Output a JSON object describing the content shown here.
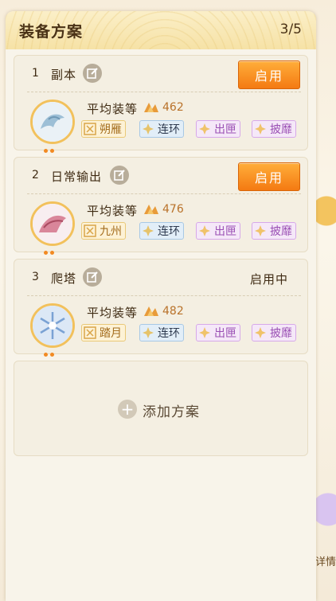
{
  "panel": {
    "title": "装备方案",
    "count": "3/5"
  },
  "plans": [
    {
      "num": "1",
      "name": "副本",
      "button": "启用",
      "avg_label": "平均装等",
      "avg_value": "462",
      "tags": {
        "gold": "朔雁",
        "blue": "连环",
        "purple1": "出匣",
        "purple2": "披靡"
      },
      "avatar": "dragon-avatar"
    },
    {
      "num": "2",
      "name": "日常输出",
      "button": "启用",
      "avg_label": "平均装等",
      "avg_value": "476",
      "tags": {
        "gold": "九州",
        "blue": "连环",
        "purple1": "出匣",
        "purple2": "披靡"
      },
      "avatar": "phoenix-avatar"
    },
    {
      "num": "3",
      "name": "爬塔",
      "status": "启用中",
      "avg_label": "平均装等",
      "avg_value": "482",
      "tags": {
        "gold": "踏月",
        "blue": "连环",
        "purple1": "出匣",
        "purple2": "披靡"
      },
      "avatar": "snowflake-avatar"
    }
  ],
  "add": {
    "label": "添加方案"
  },
  "background": {
    "right_text": "详情"
  },
  "colors": {
    "accent": "#f47a12",
    "header": "#f6e2a6",
    "text": "#3e2a12"
  }
}
